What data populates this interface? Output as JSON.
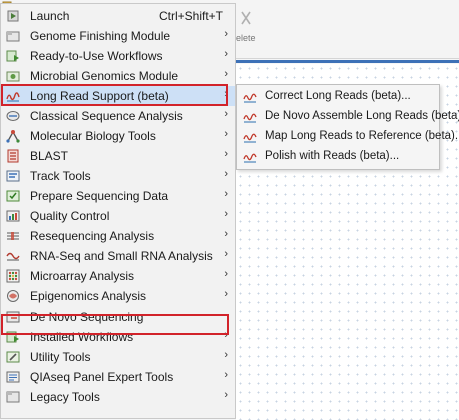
{
  "background": {
    "toolbar_label": "elete"
  },
  "menu": {
    "items": [
      {
        "name": "menu-item-launch",
        "icon": "launch-icon",
        "label": "Launch",
        "shortcut": "Ctrl+Shift+T",
        "has_submenu": false
      },
      {
        "name": "menu-item-genome-finishing-module",
        "icon": "genome-finishing-icon",
        "label": "Genome Finishing Module",
        "has_submenu": true
      },
      {
        "name": "menu-item-ready-to-use-workflows",
        "icon": "workflow-icon",
        "label": "Ready-to-Use Workflows",
        "has_submenu": true
      },
      {
        "name": "menu-item-microbial-genomics-module",
        "icon": "microbial-genomics-icon",
        "label": "Microbial Genomics Module",
        "has_submenu": true
      },
      {
        "name": "menu-item-long-read-support",
        "icon": "long-read-icon",
        "label": "Long Read Support (beta)",
        "has_submenu": true,
        "selected": true
      },
      {
        "name": "menu-item-classical-sequence-analysis",
        "icon": "classical-sequence-icon",
        "label": "Classical Sequence Analysis",
        "has_submenu": true
      },
      {
        "name": "menu-item-molecular-biology-tools",
        "icon": "molecular-biology-icon",
        "label": "Molecular Biology Tools",
        "has_submenu": true
      },
      {
        "name": "menu-item-blast",
        "icon": "blast-icon",
        "label": "BLAST",
        "has_submenu": true
      },
      {
        "name": "menu-item-track-tools",
        "icon": "track-tools-icon",
        "label": "Track Tools",
        "has_submenu": true
      },
      {
        "name": "menu-item-prepare-sequencing-data",
        "icon": "prepare-data-icon",
        "label": "Prepare Sequencing Data",
        "has_submenu": true
      },
      {
        "name": "menu-item-quality-control",
        "icon": "quality-control-icon",
        "label": "Quality Control",
        "has_submenu": true
      },
      {
        "name": "menu-item-resequencing-analysis",
        "icon": "resequencing-icon",
        "label": "Resequencing Analysis",
        "has_submenu": true
      },
      {
        "name": "menu-item-rna-seq",
        "icon": "rna-seq-icon",
        "label": "RNA-Seq and Small RNA Analysis",
        "has_submenu": true
      },
      {
        "name": "menu-item-microarray-analysis",
        "icon": "microarray-icon",
        "label": "Microarray Analysis",
        "has_submenu": true
      },
      {
        "name": "menu-item-epigenomics-analysis",
        "icon": "epigenomics-icon",
        "label": "Epigenomics Analysis",
        "has_submenu": true
      },
      {
        "name": "menu-item-de-novo-sequencing",
        "icon": "de-novo-icon",
        "label": "De Novo Sequencing",
        "has_submenu": false,
        "highlighted": true
      },
      {
        "name": "menu-item-installed-workflows",
        "icon": "installed-workflows-icon",
        "label": "Installed Workflows",
        "has_submenu": true
      },
      {
        "name": "menu-item-utility-tools",
        "icon": "utility-tools-icon",
        "label": "Utility Tools",
        "has_submenu": true
      },
      {
        "name": "menu-item-qiaseq-panel-expert-tools",
        "icon": "qiaseq-icon",
        "label": "QIAseq Panel Expert Tools",
        "has_submenu": true
      },
      {
        "name": "menu-item-legacy-tools",
        "icon": "legacy-tools-icon",
        "label": "Legacy Tools",
        "has_submenu": true
      }
    ]
  },
  "submenu": {
    "items": [
      {
        "name": "submenu-item-correct-long-reads",
        "icon": "long-read-tool-icon",
        "label": "Correct Long Reads (beta)..."
      },
      {
        "name": "submenu-item-de-novo-assemble-long-reads",
        "icon": "long-read-tool-icon",
        "label": "De Novo Assemble Long Reads (beta)..."
      },
      {
        "name": "submenu-item-map-long-reads",
        "icon": "long-read-tool-icon",
        "label": "Map Long Reads to Reference (beta)..."
      },
      {
        "name": "submenu-item-polish-with-reads",
        "icon": "long-read-tool-icon",
        "label": "Polish with Reads (beta)..."
      }
    ]
  },
  "colors": {
    "highlight_border": "#d2232a",
    "selected_background": "#cde0f6",
    "accent_blue": "#3d71b7"
  }
}
